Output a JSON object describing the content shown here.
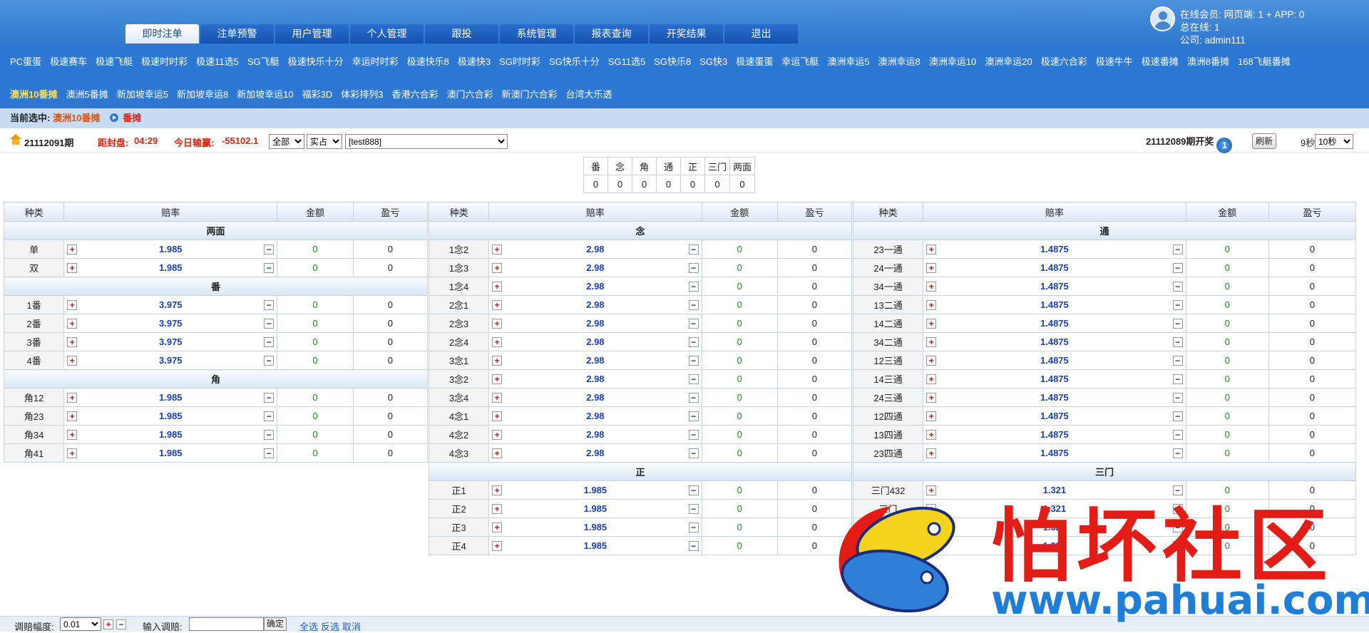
{
  "header": {
    "tabs": [
      "即时注单",
      "注单预警",
      "用户管理",
      "个人管理",
      "跟投",
      "系统管理",
      "报表查询",
      "开奖结果",
      "退出"
    ],
    "active_tab": "即时注单",
    "user": {
      "line1": "在线会员:  网页端: 1 + APP: 0",
      "line2": "总在线: 1",
      "line3": "公司: admin111"
    }
  },
  "games_row1": [
    "PC蛋蛋",
    "极速赛车",
    "极速飞艇",
    "极速时时彩",
    "极速11选5",
    "SG飞艇",
    "极速快乐十分",
    "幸运时时彩",
    "极速快乐8",
    "极速快3",
    "SG时时彩",
    "SG快乐十分",
    "SG11选5",
    "SG快乐8",
    "SG快3",
    "极速蛋蛋",
    "幸运飞艇",
    "澳洲幸运5",
    "澳洲幸运8",
    "澳洲幸运10",
    "澳洲幸运20",
    "极速六合彩",
    "极速牛牛",
    "极速番摊",
    "澳洲8番摊",
    "168飞艇番摊"
  ],
  "games_row2": [
    "澳洲10番摊",
    "澳洲5番摊",
    "新加坡幸运5",
    "新加坡幸运8",
    "新加坡幸运10",
    "福彩3D",
    "体彩排列3",
    "香港六合彩",
    "澳门六合彩",
    "新澳门六合彩",
    "台湾大乐透"
  ],
  "active_game": "澳洲10番摊",
  "crumb": {
    "label": "当前选中:",
    "game": "澳洲10番摊",
    "play": "番摊"
  },
  "toolbar": {
    "period": "21112091期",
    "close_label": "距封盘:",
    "close_time": "04:29",
    "profit_label": "今日输赢:",
    "profit": "-55102.1",
    "select_all": "全部",
    "select_real": "实占",
    "select_user": "[test888]",
    "draw_text": "21112089期开奖",
    "draw_badge": "1",
    "refresh": "刷新",
    "seconds": "9秒",
    "interval": "10秒"
  },
  "summary": {
    "headers": [
      "番",
      "念",
      "角",
      "通",
      "正",
      "三门",
      "两面"
    ],
    "values": [
      "0",
      "0",
      "0",
      "0",
      "0",
      "0",
      "0"
    ]
  },
  "col_headers": [
    "种类",
    "赔率",
    "金额",
    "盈亏"
  ],
  "panels": [
    {
      "sections": [
        {
          "title": "两面",
          "rows": [
            {
              "n": "单",
              "o": "1.985",
              "a": "0",
              "p": "0"
            },
            {
              "n": "双",
              "o": "1.985",
              "a": "0",
              "p": "0"
            }
          ]
        },
        {
          "title": "番",
          "rows": [
            {
              "n": "1番",
              "o": "3.975",
              "a": "0",
              "p": "0"
            },
            {
              "n": "2番",
              "o": "3.975",
              "a": "0",
              "p": "0"
            },
            {
              "n": "3番",
              "o": "3.975",
              "a": "0",
              "p": "0"
            },
            {
              "n": "4番",
              "o": "3.975",
              "a": "0",
              "p": "0"
            }
          ]
        },
        {
          "title": "角",
          "rows": [
            {
              "n": "角12",
              "o": "1.985",
              "a": "0",
              "p": "0"
            },
            {
              "n": "角23",
              "o": "1.985",
              "a": "0",
              "p": "0"
            },
            {
              "n": "角34",
              "o": "1.985",
              "a": "0",
              "p": "0"
            },
            {
              "n": "角41",
              "o": "1.985",
              "a": "0",
              "p": "0"
            }
          ]
        }
      ]
    },
    {
      "sections": [
        {
          "title": "念",
          "rows": [
            {
              "n": "1念2",
              "o": "2.98",
              "a": "0",
              "p": "0"
            },
            {
              "n": "1念3",
              "o": "2.98",
              "a": "0",
              "p": "0"
            },
            {
              "n": "1念4",
              "o": "2.98",
              "a": "0",
              "p": "0"
            },
            {
              "n": "2念1",
              "o": "2.98",
              "a": "0",
              "p": "0"
            },
            {
              "n": "2念3",
              "o": "2.98",
              "a": "0",
              "p": "0"
            },
            {
              "n": "2念4",
              "o": "2.98",
              "a": "0",
              "p": "0"
            },
            {
              "n": "3念1",
              "o": "2.98",
              "a": "0",
              "p": "0"
            },
            {
              "n": "3念2",
              "o": "2.98",
              "a": "0",
              "p": "0"
            },
            {
              "n": "3念4",
              "o": "2.98",
              "a": "0",
              "p": "0"
            },
            {
              "n": "4念1",
              "o": "2.98",
              "a": "0",
              "p": "0"
            },
            {
              "n": "4念2",
              "o": "2.98",
              "a": "0",
              "p": "0"
            },
            {
              "n": "4念3",
              "o": "2.98",
              "a": "0",
              "p": "0"
            }
          ]
        },
        {
          "title": "正",
          "rows": [
            {
              "n": "正1",
              "o": "1.985",
              "a": "0",
              "p": "0"
            },
            {
              "n": "正2",
              "o": "1.985",
              "a": "0",
              "p": "0"
            },
            {
              "n": "正3",
              "o": "1.985",
              "a": "0",
              "p": "0"
            },
            {
              "n": "正4",
              "o": "1.985",
              "a": "0",
              "p": "0"
            }
          ]
        }
      ]
    },
    {
      "sections": [
        {
          "title": "通",
          "rows": [
            {
              "n": "23一通",
              "o": "1.4875",
              "a": "0",
              "p": "0"
            },
            {
              "n": "24一通",
              "o": "1.4875",
              "a": "0",
              "p": "0"
            },
            {
              "n": "34一通",
              "o": "1.4875",
              "a": "0",
              "p": "0"
            },
            {
              "n": "13二通",
              "o": "1.4875",
              "a": "0",
              "p": "0"
            },
            {
              "n": "14二通",
              "o": "1.4875",
              "a": "0",
              "p": "0"
            },
            {
              "n": "34二通",
              "o": "1.4875",
              "a": "0",
              "p": "0"
            },
            {
              "n": "12三通",
              "o": "1.4875",
              "a": "0",
              "p": "0"
            },
            {
              "n": "14三通",
              "o": "1.4875",
              "a": "0",
              "p": "0"
            },
            {
              "n": "24三通",
              "o": "1.4875",
              "a": "0",
              "p": "0"
            },
            {
              "n": "12四通",
              "o": "1.4875",
              "a": "0",
              "p": "0"
            },
            {
              "n": "13四通",
              "o": "1.4875",
              "a": "0",
              "p": "0"
            },
            {
              "n": "23四通",
              "o": "1.4875",
              "a": "0",
              "p": "0"
            }
          ]
        },
        {
          "title": "三门",
          "rows": [
            {
              "n": "三门432",
              "o": "1.321",
              "a": "0",
              "p": "0"
            },
            {
              "n": "三门",
              "o": "1.321",
              "a": "0",
              "p": "0"
            },
            {
              "n": "三门",
              "o": "1.321",
              "a": "0",
              "p": "0"
            },
            {
              "n": "三门",
              "o": "1.321",
              "a": "0",
              "p": "0"
            }
          ]
        }
      ]
    }
  ],
  "bottom": {
    "step_label": "调赔幅度:",
    "step_value": "0.01",
    "input_label": "输入调赔:",
    "confirm": "确定",
    "select_all": "全选",
    "invert": "反选",
    "cancel": "取消"
  },
  "watermark": {
    "text": "怕坏社区",
    "url": "www.pahuai.com"
  },
  "colors": {
    "header_blue": "#2f78cf",
    "odds_blue": "#1a3fbf",
    "amount_green": "#168f16",
    "alert_red": "#e0240f"
  }
}
